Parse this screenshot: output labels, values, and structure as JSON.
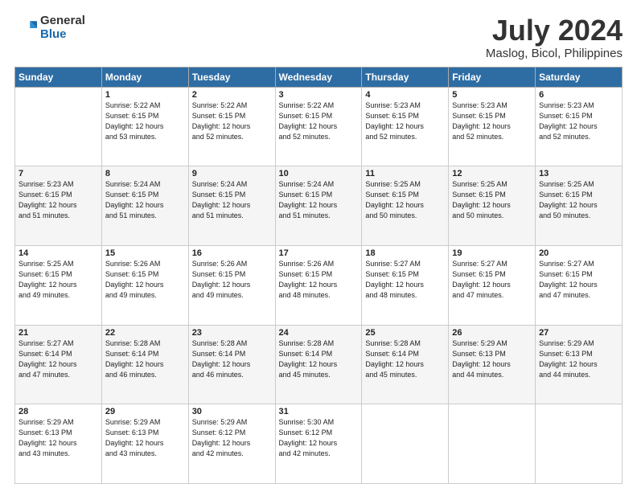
{
  "header": {
    "logo_general": "General",
    "logo_blue": "Blue",
    "title": "July 2024",
    "subtitle": "Maslog, Bicol, Philippines"
  },
  "calendar": {
    "headers": [
      "Sunday",
      "Monday",
      "Tuesday",
      "Wednesday",
      "Thursday",
      "Friday",
      "Saturday"
    ],
    "rows": [
      [
        {
          "day": "",
          "info": ""
        },
        {
          "day": "1",
          "info": "Sunrise: 5:22 AM\nSunset: 6:15 PM\nDaylight: 12 hours\nand 53 minutes."
        },
        {
          "day": "2",
          "info": "Sunrise: 5:22 AM\nSunset: 6:15 PM\nDaylight: 12 hours\nand 52 minutes."
        },
        {
          "day": "3",
          "info": "Sunrise: 5:22 AM\nSunset: 6:15 PM\nDaylight: 12 hours\nand 52 minutes."
        },
        {
          "day": "4",
          "info": "Sunrise: 5:23 AM\nSunset: 6:15 PM\nDaylight: 12 hours\nand 52 minutes."
        },
        {
          "day": "5",
          "info": "Sunrise: 5:23 AM\nSunset: 6:15 PM\nDaylight: 12 hours\nand 52 minutes."
        },
        {
          "day": "6",
          "info": "Sunrise: 5:23 AM\nSunset: 6:15 PM\nDaylight: 12 hours\nand 52 minutes."
        }
      ],
      [
        {
          "day": "7",
          "info": "Sunrise: 5:23 AM\nSunset: 6:15 PM\nDaylight: 12 hours\nand 51 minutes."
        },
        {
          "day": "8",
          "info": "Sunrise: 5:24 AM\nSunset: 6:15 PM\nDaylight: 12 hours\nand 51 minutes."
        },
        {
          "day": "9",
          "info": "Sunrise: 5:24 AM\nSunset: 6:15 PM\nDaylight: 12 hours\nand 51 minutes."
        },
        {
          "day": "10",
          "info": "Sunrise: 5:24 AM\nSunset: 6:15 PM\nDaylight: 12 hours\nand 51 minutes."
        },
        {
          "day": "11",
          "info": "Sunrise: 5:25 AM\nSunset: 6:15 PM\nDaylight: 12 hours\nand 50 minutes."
        },
        {
          "day": "12",
          "info": "Sunrise: 5:25 AM\nSunset: 6:15 PM\nDaylight: 12 hours\nand 50 minutes."
        },
        {
          "day": "13",
          "info": "Sunrise: 5:25 AM\nSunset: 6:15 PM\nDaylight: 12 hours\nand 50 minutes."
        }
      ],
      [
        {
          "day": "14",
          "info": "Sunrise: 5:25 AM\nSunset: 6:15 PM\nDaylight: 12 hours\nand 49 minutes."
        },
        {
          "day": "15",
          "info": "Sunrise: 5:26 AM\nSunset: 6:15 PM\nDaylight: 12 hours\nand 49 minutes."
        },
        {
          "day": "16",
          "info": "Sunrise: 5:26 AM\nSunset: 6:15 PM\nDaylight: 12 hours\nand 49 minutes."
        },
        {
          "day": "17",
          "info": "Sunrise: 5:26 AM\nSunset: 6:15 PM\nDaylight: 12 hours\nand 48 minutes."
        },
        {
          "day": "18",
          "info": "Sunrise: 5:27 AM\nSunset: 6:15 PM\nDaylight: 12 hours\nand 48 minutes."
        },
        {
          "day": "19",
          "info": "Sunrise: 5:27 AM\nSunset: 6:15 PM\nDaylight: 12 hours\nand 47 minutes."
        },
        {
          "day": "20",
          "info": "Sunrise: 5:27 AM\nSunset: 6:15 PM\nDaylight: 12 hours\nand 47 minutes."
        }
      ],
      [
        {
          "day": "21",
          "info": "Sunrise: 5:27 AM\nSunset: 6:14 PM\nDaylight: 12 hours\nand 47 minutes."
        },
        {
          "day": "22",
          "info": "Sunrise: 5:28 AM\nSunset: 6:14 PM\nDaylight: 12 hours\nand 46 minutes."
        },
        {
          "day": "23",
          "info": "Sunrise: 5:28 AM\nSunset: 6:14 PM\nDaylight: 12 hours\nand 46 minutes."
        },
        {
          "day": "24",
          "info": "Sunrise: 5:28 AM\nSunset: 6:14 PM\nDaylight: 12 hours\nand 45 minutes."
        },
        {
          "day": "25",
          "info": "Sunrise: 5:28 AM\nSunset: 6:14 PM\nDaylight: 12 hours\nand 45 minutes."
        },
        {
          "day": "26",
          "info": "Sunrise: 5:29 AM\nSunset: 6:13 PM\nDaylight: 12 hours\nand 44 minutes."
        },
        {
          "day": "27",
          "info": "Sunrise: 5:29 AM\nSunset: 6:13 PM\nDaylight: 12 hours\nand 44 minutes."
        }
      ],
      [
        {
          "day": "28",
          "info": "Sunrise: 5:29 AM\nSunset: 6:13 PM\nDaylight: 12 hours\nand 43 minutes."
        },
        {
          "day": "29",
          "info": "Sunrise: 5:29 AM\nSunset: 6:13 PM\nDaylight: 12 hours\nand 43 minutes."
        },
        {
          "day": "30",
          "info": "Sunrise: 5:29 AM\nSunset: 6:12 PM\nDaylight: 12 hours\nand 42 minutes."
        },
        {
          "day": "31",
          "info": "Sunrise: 5:30 AM\nSunset: 6:12 PM\nDaylight: 12 hours\nand 42 minutes."
        },
        {
          "day": "",
          "info": ""
        },
        {
          "day": "",
          "info": ""
        },
        {
          "day": "",
          "info": ""
        }
      ]
    ]
  }
}
